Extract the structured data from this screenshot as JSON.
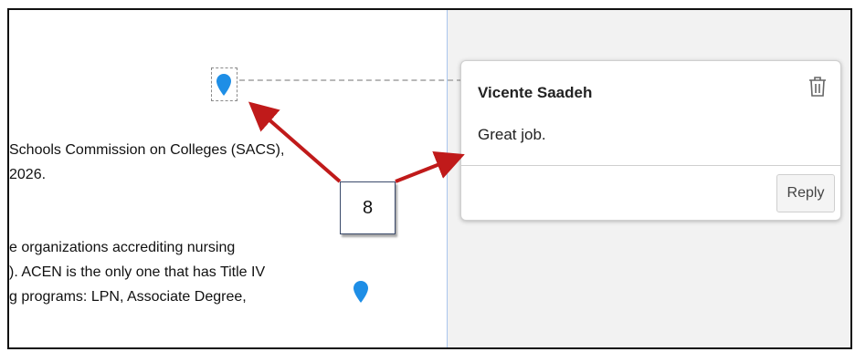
{
  "document": {
    "lines": [
      "Schools Commission on Colleges (SACS),",
      "2026.",
      "e organizations accrediting nursing",
      "). ACEN is the only one that has Title IV",
      "g programs: LPN, Associate Degree,",
      ""
    ]
  },
  "comment": {
    "author": "Vicente Saadeh",
    "text": "Great job.",
    "reply_label": "Reply"
  },
  "annotation": {
    "callout_number": "8",
    "arrow_color": "#c01a1a"
  },
  "colors": {
    "pin": "#1e8ee6",
    "divider": "#a9c6ee",
    "sidebar_bg": "#f2f2f2"
  },
  "icons": {
    "pin": "location-pin-icon",
    "delete": "trash-icon"
  }
}
